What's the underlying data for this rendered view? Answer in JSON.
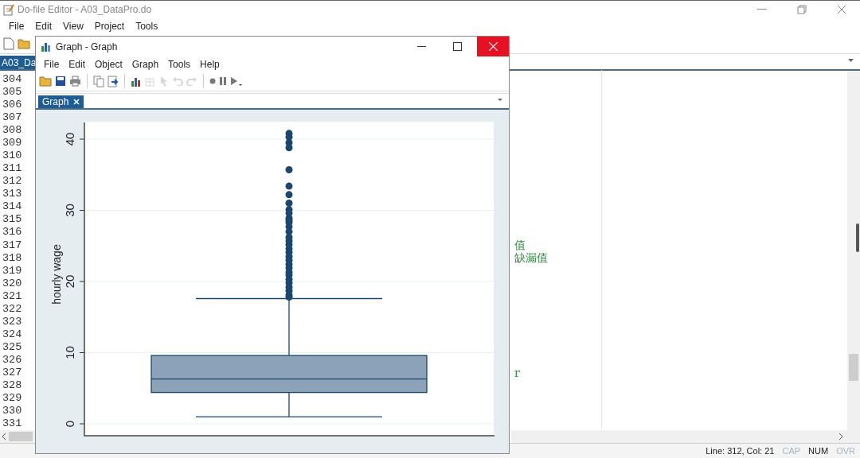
{
  "editor": {
    "title": "Do-file Editor - A03_DataPro.do",
    "menu": [
      "File",
      "Edit",
      "View",
      "Project",
      "Tools"
    ],
    "toolbar": [
      {
        "kind": "new"
      },
      {
        "kind": "open"
      }
    ],
    "tab": {
      "label": "A03_Da",
      "selected": true
    },
    "lines": [
      {
        "number": "304"
      },
      {
        "number": "305"
      },
      {
        "number": "306"
      },
      {
        "number": "307"
      },
      {
        "number": "308"
      },
      {
        "number": "309"
      },
      {
        "number": "310"
      },
      {
        "number": "311"
      },
      {
        "number": "312"
      },
      {
        "number": "313"
      },
      {
        "number": "314"
      },
      {
        "number": "315"
      },
      {
        "number": "316"
      },
      {
        "number": "317",
        "text": "值"
      },
      {
        "number": "318",
        "text": "缺漏值"
      },
      {
        "number": "319"
      },
      {
        "number": "320"
      },
      {
        "number": "321"
      },
      {
        "number": "322"
      },
      {
        "number": "323"
      },
      {
        "number": "324"
      },
      {
        "number": "325"
      },
      {
        "number": "326"
      },
      {
        "number": "327",
        "text": "r"
      },
      {
        "number": "328"
      },
      {
        "number": "329"
      },
      {
        "number": "330"
      },
      {
        "number": "331"
      }
    ],
    "status": {
      "position": "Line: 312, Col: 21",
      "indicators": [
        {
          "label": "CAP",
          "on": false
        },
        {
          "label": "NUM",
          "on": true
        },
        {
          "label": "OVR",
          "on": false
        }
      ]
    }
  },
  "graph_window": {
    "title": "Graph - Graph",
    "menu": [
      "File",
      "Edit",
      "Object",
      "Graph",
      "Tools",
      "Help"
    ],
    "toolbar": [
      {
        "kind": "open",
        "disabled": false
      },
      {
        "kind": "save",
        "disabled": false
      },
      {
        "kind": "print",
        "disabled": false
      },
      {
        "kind": "sep"
      },
      {
        "kind": "copy",
        "disabled": false
      },
      {
        "kind": "paste",
        "disabled": false
      },
      {
        "kind": "sep"
      },
      {
        "kind": "chart",
        "disabled": false
      },
      {
        "kind": "grid",
        "disabled": true
      },
      {
        "kind": "pointer",
        "disabled": true
      },
      {
        "kind": "undo",
        "disabled": true
      },
      {
        "kind": "redo",
        "disabled": true
      },
      {
        "kind": "sep"
      },
      {
        "kind": "record",
        "disabled": false
      },
      {
        "kind": "pause",
        "disabled": false
      },
      {
        "kind": "play",
        "disabled": false
      }
    ],
    "tab": {
      "label": "Graph",
      "selected": true
    },
    "plot": {
      "y_axis_title": "hourly wage",
      "y_ticks": [
        "0",
        "10",
        "20",
        "30",
        "40"
      ]
    }
  }
}
